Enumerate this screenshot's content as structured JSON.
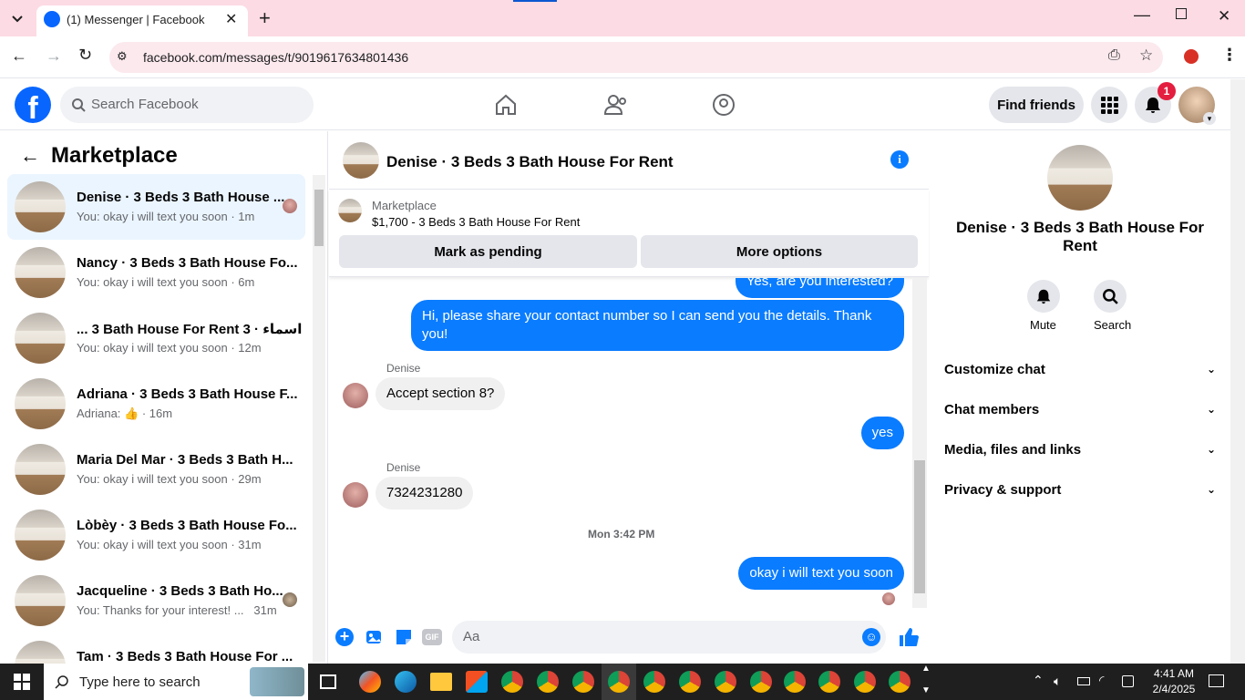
{
  "browser": {
    "tab_title": "(1) Messenger | Facebook",
    "url": "facebook.com/messages/t/9019617634801436"
  },
  "fb_header": {
    "search_placeholder": "Search Facebook",
    "find_friends": "Find friends",
    "notification_count": "1"
  },
  "sidebar": {
    "title": "Marketplace",
    "conversations": [
      {
        "name": "Denise · 3 Beds 3 Bath House ...",
        "preview": "You: okay i will text you soon · 1m",
        "active": true
      },
      {
        "name": "Nancy · 3 Beds 3 Bath House Fo...",
        "preview": "You: okay i will text you soon · 6m"
      },
      {
        "name": "... 3 Bath House For Rent 3 · اسماء",
        "preview": "You: okay i will text you soon · 12m"
      },
      {
        "name": "Adriana · 3 Beds 3 Bath House F...",
        "preview_prefix": "Adriana:",
        "preview_suffix": "· 16m"
      },
      {
        "name": "Maria Del Mar · 3 Beds 3 Bath H...",
        "preview": "You: okay i will text you soon · 29m"
      },
      {
        "name": "Lòbèy · 3 Beds 3 Bath House Fo...",
        "preview": "You: okay i will text you soon · 31m"
      },
      {
        "name": "Jacqueline · 3 Beds 3 Bath Ho...",
        "preview": "You: Thanks for your interest! ...",
        "time": "31m"
      },
      {
        "name": "Tam · 3 Beds 3 Bath House For ..."
      }
    ]
  },
  "chat": {
    "title": "Denise · 3 Beds 3 Bath House For Rent",
    "listing_label": "Marketplace",
    "listing_desc": "$1,700 - 3 Beds 3 Bath House For Rent",
    "mark_pending": "Mark as pending",
    "more_options": "More options",
    "messages": {
      "m0": "Yes, are you interested?",
      "m1": "Hi, please share your contact number so I can send you the details. Thank you!",
      "sender1": "Denise",
      "m2": "Accept section 8?",
      "m3": "yes",
      "sender2": "Denise",
      "m4": "7324231280",
      "timestamp": "Mon 3:42 PM",
      "m5": "okay i will text you soon"
    },
    "composer_placeholder": "Aa",
    "accent": "#0a7cff"
  },
  "right_panel": {
    "name": "Denise · 3 Beds 3 Bath House For Rent",
    "mute": "Mute",
    "search": "Search",
    "rows": [
      "Customize chat",
      "Chat members",
      "Media, files and links",
      "Privacy & support"
    ]
  },
  "taskbar": {
    "search_placeholder": "Type here to search",
    "time": "4:41 AM",
    "date": "2/4/2025"
  }
}
